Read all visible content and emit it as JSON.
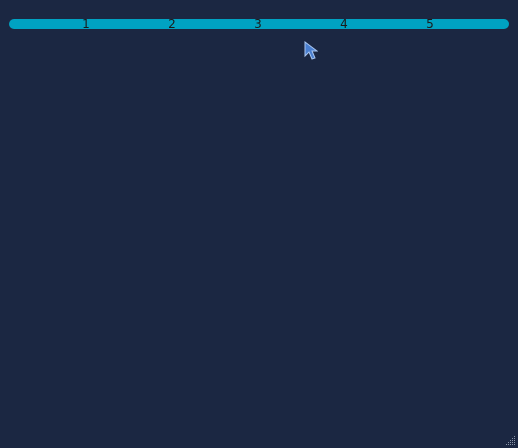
{
  "scale": {
    "ticks": [
      {
        "label": "1"
      },
      {
        "label": "2"
      },
      {
        "label": "3"
      },
      {
        "label": "4"
      },
      {
        "label": "5"
      }
    ]
  },
  "icons": {
    "cursor": "pointer-cursor-icon",
    "resize": "resize-grip-icon"
  },
  "colors": {
    "background": "#1b2742",
    "track": "#00a2c2",
    "label": "#1a1a1a"
  }
}
